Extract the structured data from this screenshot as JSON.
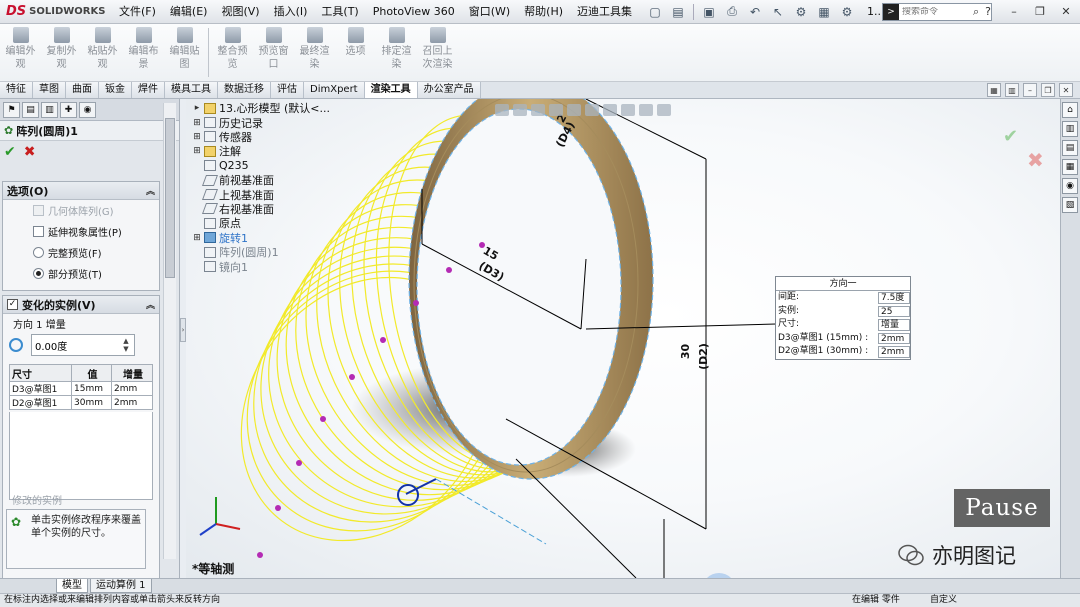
{
  "app": {
    "logo_brand": "DS",
    "logo_name": "SOLIDWORKS",
    "menu": [
      "文件(F)",
      "编辑(E)",
      "视图(V)",
      "插入(I)",
      "工具(T)",
      "PhotoView 360",
      "窗口(W)",
      "帮助(H)",
      "迈迪工具集"
    ],
    "title_suffix": "1...",
    "search_placeholder": "搜索命令"
  },
  "toolbar": {
    "tools": [
      "编辑外观",
      "复制外观",
      "粘贴外观",
      "编辑布景",
      "编辑贴图",
      "整合预览",
      "预览窗口",
      "最终渲染",
      "选项",
      "排定渲染",
      "召回上次渲染"
    ]
  },
  "cmd_tabs": {
    "items": [
      "特征",
      "草图",
      "曲面",
      "钣金",
      "焊件",
      "模具工具",
      "数据迁移",
      "评估",
      "DimXpert",
      "渲染工具",
      "办公室产品"
    ],
    "active": "渲染工具"
  },
  "property_manager": {
    "feature_title": "阵列(圆周)1",
    "help": "?",
    "options": {
      "header": "选项(O)",
      "geometry_pattern": "几何体阵列(G)",
      "propagate_visual": "延伸视象属性(P)",
      "full_preview": "完整预览(F)",
      "partial_preview": "部分预览(T)"
    },
    "varying": {
      "header": "变化的实例(V)",
      "direction_label": "方向 1 增量",
      "angle_value": "0.00度",
      "columns": [
        "尺寸",
        "值",
        "增量"
      ],
      "rows": [
        [
          "D3@草图1",
          "15mm",
          "2mm"
        ],
        [
          "D2@草图1",
          "30mm",
          "2mm"
        ]
      ]
    },
    "modified_label": "修改的实例",
    "message": "单击实例修改程序来覆盖单个实例的尺寸。"
  },
  "feature_tree": {
    "root": "13.心形模型 (默认<...",
    "items": [
      {
        "label": "历史记录",
        "style": "normal"
      },
      {
        "label": "传感器",
        "style": "normal"
      },
      {
        "label": "注解",
        "style": "normal"
      },
      {
        "label": "Q235",
        "style": "normal"
      },
      {
        "label": "前视基准面",
        "style": "normal"
      },
      {
        "label": "上视基准面",
        "style": "normal"
      },
      {
        "label": "右视基准面",
        "style": "normal"
      },
      {
        "label": "原点",
        "style": "normal"
      },
      {
        "label": "旋转1",
        "style": "blue"
      },
      {
        "label": "阵列(圆周)1",
        "style": "gray"
      },
      {
        "label": "镜向1",
        "style": "gray"
      }
    ]
  },
  "callout": {
    "header": "方向一",
    "rows": [
      {
        "key": "间距:",
        "value": "7.5度"
      },
      {
        "key": "实例:",
        "value": "25"
      },
      {
        "key": "尺寸:",
        "value": "增量"
      },
      {
        "key": "D3@草图1 (15mm) :",
        "value": "2mm"
      },
      {
        "key": "D2@草图1 (30mm) :",
        "value": "2mm"
      }
    ]
  },
  "dimensions": {
    "top_value": "2",
    "top_name": "(D4)",
    "mid_value": "15",
    "mid_name": "(D3)",
    "right_value": "30",
    "right_name": "(D2)"
  },
  "viewport": {
    "view_orientation": "*等轴测",
    "pause_label": "Pause",
    "watermark": "亦明图记"
  },
  "bottom_tabs": [
    "模型",
    "运动算例 1"
  ],
  "status": {
    "hint": "在标注内选择或来编辑排列内容或单击箭头来反转方向",
    "mode": "在编辑 零件",
    "unit": "自定义"
  },
  "colors": {
    "ring": "#b59a63",
    "pattern": "#f2ea2a",
    "selection": "#6fb2e6",
    "brand": "#c8102e"
  }
}
